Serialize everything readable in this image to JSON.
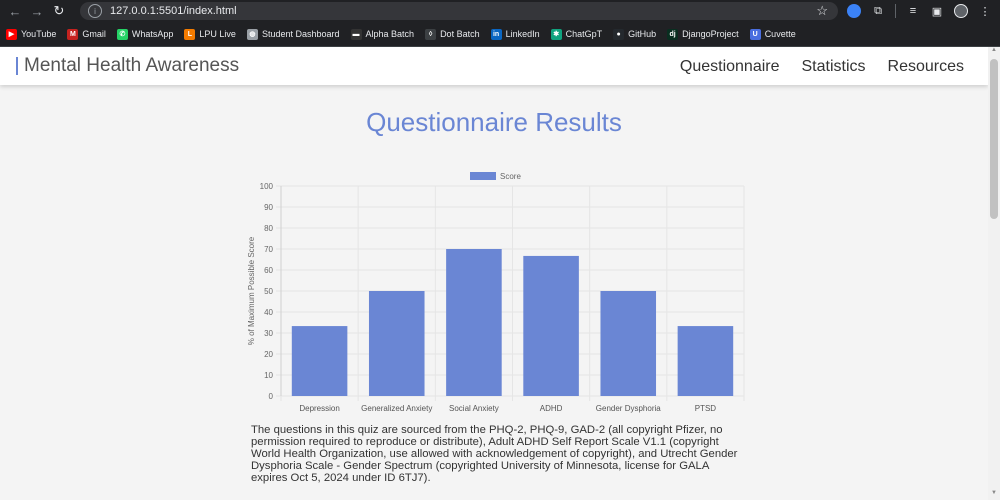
{
  "browser": {
    "url": "127.0.0.1:5501/index.html",
    "bookmarks": [
      {
        "label": "YouTube",
        "icon": "youtube-icon",
        "color": "#ff0000",
        "glyph": "▶"
      },
      {
        "label": "Gmail",
        "icon": "gmail-icon",
        "color": "#c5221f",
        "glyph": "M"
      },
      {
        "label": "WhatsApp",
        "icon": "whatsapp-icon",
        "color": "#25d366",
        "glyph": "✆"
      },
      {
        "label": "LPU Live",
        "icon": "lpu-live-icon",
        "color": "#f57c00",
        "glyph": "L"
      },
      {
        "label": "Student Dashboard",
        "icon": "globe-icon",
        "color": "#9aa0a6",
        "glyph": "◍"
      },
      {
        "label": "Alpha Batch",
        "icon": "alpha-batch-icon",
        "color": "#333333",
        "glyph": "▬"
      },
      {
        "label": "Dot Batch",
        "icon": "dot-batch-icon",
        "color": "#3c4043",
        "glyph": "◊"
      },
      {
        "label": "LinkedIn",
        "icon": "linkedin-icon",
        "color": "#0a66c2",
        "glyph": "in"
      },
      {
        "label": "ChatGpT",
        "icon": "chatgpt-icon",
        "color": "#10a37f",
        "glyph": "✱"
      },
      {
        "label": "GitHub",
        "icon": "github-icon",
        "color": "#24292e",
        "glyph": "●"
      },
      {
        "label": "DjangoProject",
        "icon": "django-icon",
        "color": "#092e20",
        "glyph": "dj"
      },
      {
        "label": "Cuvette",
        "icon": "cuvette-icon",
        "color": "#4a6ee0",
        "glyph": "U"
      }
    ]
  },
  "header": {
    "brand": "Mental Health Awareness",
    "nav": [
      "Questionnaire",
      "Statistics",
      "Resources"
    ]
  },
  "main": {
    "title": "Questionnaire Results",
    "source_text": "The questions in this quiz are sourced from the PHQ-2, PHQ-9, GAD-2 (all copyright Pfizer, no permission required to reproduce or distribute), Adult ADHD Self Report Scale V1.1 (copyright World Health Organization, use allowed with acknowledgement of copyright), and Utrecht Gender Dysphoria Scale - Gender Spectrum (copyrighted University of Minnesota, license for GALA expires Oct 5, 2024 under ID 6TJ7)."
  },
  "chart_data": {
    "type": "bar",
    "categories": [
      "Depression",
      "Generalized Anxiety",
      "Social Anxiety",
      "ADHD",
      "Gender Dysphoria",
      "PTSD"
    ],
    "series": [
      {
        "name": "Score",
        "values": [
          33.3,
          50,
          70,
          66.7,
          50,
          33.3
        ]
      }
    ],
    "xlabel": "",
    "ylabel": "% of Maximum Possible Score",
    "ylim": [
      0,
      100
    ],
    "yticks": [
      0,
      10,
      20,
      30,
      40,
      50,
      60,
      70,
      80,
      90,
      100
    ],
    "grid": true,
    "legend": "top-center",
    "bar_color": "#6a86d4"
  },
  "colors": {
    "accent": "#6a86d4"
  }
}
